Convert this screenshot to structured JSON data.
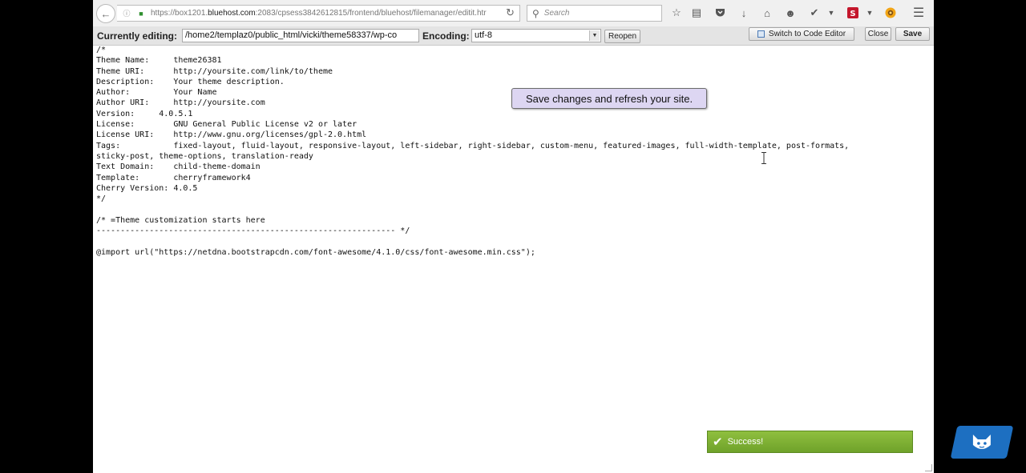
{
  "browser": {
    "url_prefix": "https://box1201.",
    "url_host": "bluehost.com",
    "url_suffix": ":2083/cpsess3842612815/frontend/bluehost/filemanager/editit.htr",
    "search_placeholder": "Search"
  },
  "editor": {
    "currently_editing_label": "Currently editing:",
    "path_value": "/home2/templaz0/public_html/vicki/theme58337/wp-co",
    "encoding_label": "Encoding:",
    "encoding_value": "utf-8",
    "reopen_label": "Reopen",
    "switch_label": "Switch to Code Editor",
    "close_label": "Close",
    "save_label": "Save",
    "code": "/*\nTheme Name:     theme26381\nTheme URI:      http://yoursite.com/link/to/theme\nDescription:    Your theme description.\nAuthor:         Your Name\nAuthor URI:     http://yoursite.com\nVersion:     4.0.5.1\nLicense:        GNU General Public License v2 or later\nLicense URI:    http://www.gnu.org/licenses/gpl-2.0.html\nTags:           fixed-layout, fluid-layout, responsive-layout, left-sidebar, right-sidebar, custom-menu, featured-images, full-width-template, post-formats,\nsticky-post, theme-options, translation-ready\nText Domain:    child-theme-domain\nTemplate:       cherryframework4\nCherry Version: 4.0.5\n*/\n\n/* =Theme customization starts here\n-------------------------------------------------------------- */\n\n@import url(\"https://netdna.bootstrapcdn.com/font-awesome/4.1.0/css/font-awesome.min.css\");"
  },
  "tooltip_text": "Save changes and refresh your site.",
  "toast_text": "Success!",
  "colors": {
    "tooltip_bg": "#ddd6f2",
    "toast_bg": "#7cb032",
    "chat_badge": "#1d6fc1"
  }
}
